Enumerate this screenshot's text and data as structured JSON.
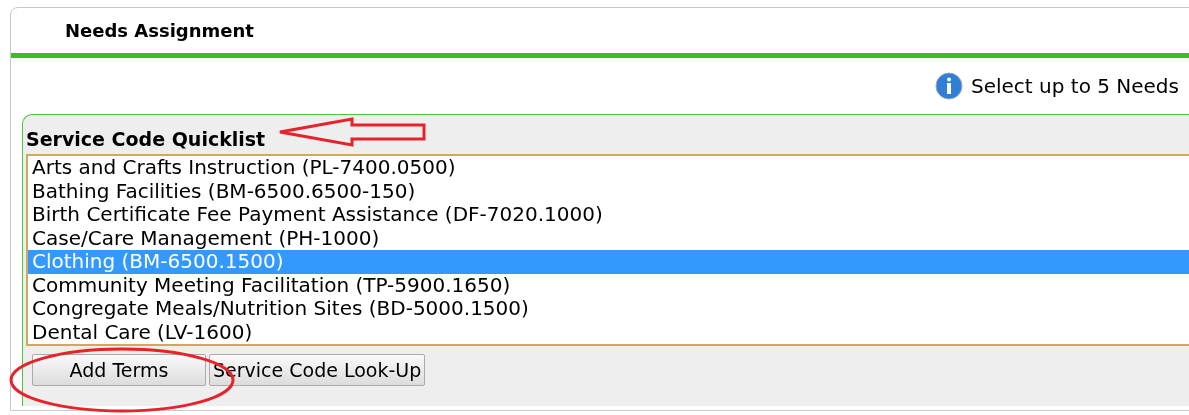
{
  "panel": {
    "title": "Needs Assignment"
  },
  "hint": "Select up to 5 Needs",
  "quicklist": {
    "title": "Service Code Quicklist",
    "items": [
      {
        "label": "Arts and Crafts Instruction (PL-7400.0500)",
        "selected": false
      },
      {
        "label": "Bathing Facilities (BM-6500.6500-150)",
        "selected": false
      },
      {
        "label": "Birth Certificate Fee Payment Assistance (DF-7020.1000)",
        "selected": false
      },
      {
        "label": "Case/Care Management (PH-1000)",
        "selected": false
      },
      {
        "label": "Clothing (BM-6500.1500)",
        "selected": true
      },
      {
        "label": "Community Meeting Facilitation (TP-5900.1650)",
        "selected": false
      },
      {
        "label": "Congregate Meals/Nutrition Sites (BD-5000.1500)",
        "selected": false
      },
      {
        "label": "Dental Care (LV-1600)",
        "selected": false
      }
    ]
  },
  "buttons": [
    "Add Terms",
    "Service Code Look-Up"
  ]
}
